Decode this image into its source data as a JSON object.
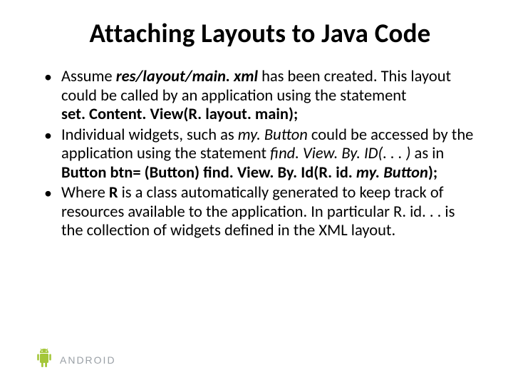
{
  "title": "Attaching Layouts to Java Code",
  "bullets": [
    {
      "t1": "Assume ",
      "path": "res/layout/main. xml",
      "t2": " has been created. This layout could be called by an application using the statement",
      "code": "set. Content. View(R. layout. main);"
    },
    {
      "t1": "Individual widgets, such as ",
      "var1": "my. Button",
      "t2": " could be accessed by the application using the statement ",
      "fn": "find. View. By. ID(. . . )",
      "t3": " as in",
      "code1": "Button btn= (Button) find. View. By. Id(R. id. ",
      "code2": "my. Button",
      "code3": ");"
    },
    {
      "t1": "Where ",
      "r": "R",
      "t2": " is a class automatically generated to keep track of resources available to the application. In particular R. id. . . is the collection of widgets defined in the XML layout."
    }
  ],
  "footer": {
    "brand": "android"
  }
}
